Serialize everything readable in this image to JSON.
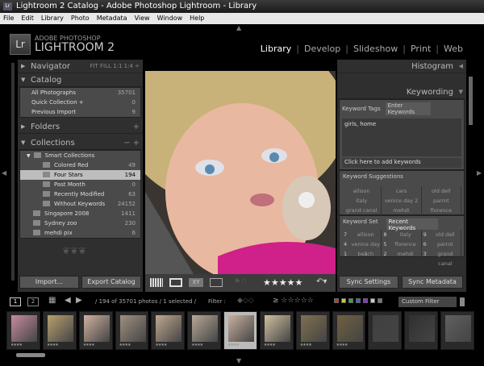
{
  "window": {
    "title": "Lightroom 2 Catalog - Adobe Photoshop Lightroom - Library",
    "icon": "Lr"
  },
  "menu": [
    "File",
    "Edit",
    "Library",
    "Photo",
    "Metadata",
    "View",
    "Window",
    "Help"
  ],
  "brand": {
    "logo": "Lr",
    "line1": "ADOBE PHOTOSHOP",
    "line2": "LIGHTROOM 2"
  },
  "modules": [
    "Library",
    "Develop",
    "Slideshow",
    "Print",
    "Web"
  ],
  "active_module": "Library",
  "left": {
    "navigator": {
      "title": "Navigator",
      "options": "FIT  FILL  1:1  1:4 ÷"
    },
    "catalog": {
      "title": "Catalog",
      "items": [
        {
          "label": "All Photographs",
          "count": "35701"
        },
        {
          "label": "Quick Collection  +",
          "count": "0"
        },
        {
          "label": "Previous Import",
          "count": "9"
        }
      ]
    },
    "folders": {
      "title": "Folders"
    },
    "collections": {
      "title": "Collections",
      "group": "Smart Collections",
      "smart": [
        {
          "label": "Colored Red",
          "count": "49"
        },
        {
          "label": "Four Stars",
          "count": "194"
        },
        {
          "label": "Past Month",
          "count": "0"
        },
        {
          "label": "Recently Modified",
          "count": "63"
        },
        {
          "label": "Without Keywords",
          "count": "24152"
        }
      ],
      "items": [
        {
          "label": "Singapore 2008",
          "count": "1411"
        },
        {
          "label": "Sydney zoo",
          "count": "230"
        },
        {
          "label": "mehdi pix",
          "count": "6"
        }
      ]
    },
    "import": "Import...",
    "export": "Export Catalog"
  },
  "right": {
    "histogram": "Histogram",
    "keywording": "Keywording",
    "keyword_tags_label": "Keyword Tags",
    "keyword_tags_mode": "Enter Keywords",
    "keywords": "girls, home",
    "add_hint": "Click here to add keywords",
    "suggestions_title": "Keyword Suggestions",
    "suggestions": [
      "allison",
      "cars",
      "old dell",
      "italy",
      "venice day 2",
      "parrot",
      "grand canal",
      "mehdi",
      "florence"
    ],
    "keyword_set_label": "Keyword Set",
    "keyword_set": "Recent Keywords",
    "set": [
      {
        "k": "7",
        "v": "allison"
      },
      {
        "k": "8",
        "v": "italy"
      },
      {
        "k": "9",
        "v": "old dell"
      },
      {
        "k": "4",
        "v": "venice day 2"
      },
      {
        "k": "5",
        "v": "florence"
      },
      {
        "k": "6",
        "v": "parrot"
      },
      {
        "k": "1",
        "v": "beach"
      },
      {
        "k": "2",
        "v": "mehdi"
      },
      {
        "k": "3",
        "v": "grand canal"
      }
    ],
    "sync_settings": "Sync Settings",
    "sync_metadata": "Sync Metadata"
  },
  "toolbar": {
    "stars": "★★★★★",
    "compare": "XY"
  },
  "filmstrip": {
    "page1": "1",
    "page2": "2",
    "status": "/ 194 of 35701 photos / 1 selected /",
    "filter_label": "Filter :",
    "filter_stars": "≥ ☆☆☆☆☆",
    "custom_filter": "Custom Filter",
    "thumb_rating": "★★★★",
    "label_colors": [
      "#c33",
      "#cc3",
      "#3a3",
      "#36c",
      "#83c",
      "#ccc",
      "#777"
    ]
  }
}
